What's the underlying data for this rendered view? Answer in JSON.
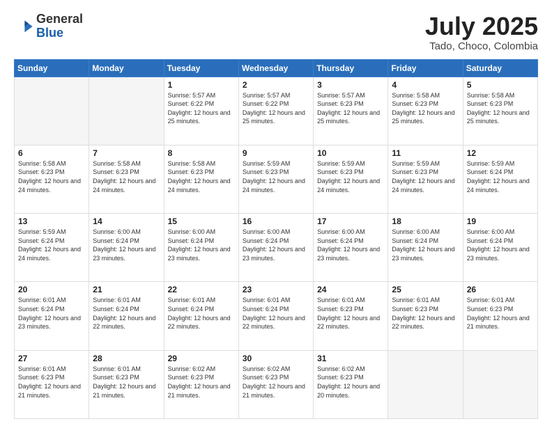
{
  "header": {
    "logo": {
      "line1": "General",
      "line2": "Blue"
    },
    "title": "July 2025",
    "location": "Tado, Choco, Colombia"
  },
  "weekdays": [
    "Sunday",
    "Monday",
    "Tuesday",
    "Wednesday",
    "Thursday",
    "Friday",
    "Saturday"
  ],
  "weeks": [
    [
      {
        "day": "",
        "empty": true
      },
      {
        "day": "",
        "empty": true
      },
      {
        "day": "1",
        "sunrise": "5:57 AM",
        "sunset": "6:22 PM",
        "daylight": "12 hours and 25 minutes."
      },
      {
        "day": "2",
        "sunrise": "5:57 AM",
        "sunset": "6:22 PM",
        "daylight": "12 hours and 25 minutes."
      },
      {
        "day": "3",
        "sunrise": "5:57 AM",
        "sunset": "6:23 PM",
        "daylight": "12 hours and 25 minutes."
      },
      {
        "day": "4",
        "sunrise": "5:58 AM",
        "sunset": "6:23 PM",
        "daylight": "12 hours and 25 minutes."
      },
      {
        "day": "5",
        "sunrise": "5:58 AM",
        "sunset": "6:23 PM",
        "daylight": "12 hours and 25 minutes."
      }
    ],
    [
      {
        "day": "6",
        "sunrise": "5:58 AM",
        "sunset": "6:23 PM",
        "daylight": "12 hours and 24 minutes."
      },
      {
        "day": "7",
        "sunrise": "5:58 AM",
        "sunset": "6:23 PM",
        "daylight": "12 hours and 24 minutes."
      },
      {
        "day": "8",
        "sunrise": "5:58 AM",
        "sunset": "6:23 PM",
        "daylight": "12 hours and 24 minutes."
      },
      {
        "day": "9",
        "sunrise": "5:59 AM",
        "sunset": "6:23 PM",
        "daylight": "12 hours and 24 minutes."
      },
      {
        "day": "10",
        "sunrise": "5:59 AM",
        "sunset": "6:23 PM",
        "daylight": "12 hours and 24 minutes."
      },
      {
        "day": "11",
        "sunrise": "5:59 AM",
        "sunset": "6:23 PM",
        "daylight": "12 hours and 24 minutes."
      },
      {
        "day": "12",
        "sunrise": "5:59 AM",
        "sunset": "6:24 PM",
        "daylight": "12 hours and 24 minutes."
      }
    ],
    [
      {
        "day": "13",
        "sunrise": "5:59 AM",
        "sunset": "6:24 PM",
        "daylight": "12 hours and 24 minutes."
      },
      {
        "day": "14",
        "sunrise": "6:00 AM",
        "sunset": "6:24 PM",
        "daylight": "12 hours and 23 minutes."
      },
      {
        "day": "15",
        "sunrise": "6:00 AM",
        "sunset": "6:24 PM",
        "daylight": "12 hours and 23 minutes."
      },
      {
        "day": "16",
        "sunrise": "6:00 AM",
        "sunset": "6:24 PM",
        "daylight": "12 hours and 23 minutes."
      },
      {
        "day": "17",
        "sunrise": "6:00 AM",
        "sunset": "6:24 PM",
        "daylight": "12 hours and 23 minutes."
      },
      {
        "day": "18",
        "sunrise": "6:00 AM",
        "sunset": "6:24 PM",
        "daylight": "12 hours and 23 minutes."
      },
      {
        "day": "19",
        "sunrise": "6:00 AM",
        "sunset": "6:24 PM",
        "daylight": "12 hours and 23 minutes."
      }
    ],
    [
      {
        "day": "20",
        "sunrise": "6:01 AM",
        "sunset": "6:24 PM",
        "daylight": "12 hours and 23 minutes."
      },
      {
        "day": "21",
        "sunrise": "6:01 AM",
        "sunset": "6:24 PM",
        "daylight": "12 hours and 22 minutes."
      },
      {
        "day": "22",
        "sunrise": "6:01 AM",
        "sunset": "6:24 PM",
        "daylight": "12 hours and 22 minutes."
      },
      {
        "day": "23",
        "sunrise": "6:01 AM",
        "sunset": "6:24 PM",
        "daylight": "12 hours and 22 minutes."
      },
      {
        "day": "24",
        "sunrise": "6:01 AM",
        "sunset": "6:23 PM",
        "daylight": "12 hours and 22 minutes."
      },
      {
        "day": "25",
        "sunrise": "6:01 AM",
        "sunset": "6:23 PM",
        "daylight": "12 hours and 22 minutes."
      },
      {
        "day": "26",
        "sunrise": "6:01 AM",
        "sunset": "6:23 PM",
        "daylight": "12 hours and 21 minutes."
      }
    ],
    [
      {
        "day": "27",
        "sunrise": "6:01 AM",
        "sunset": "6:23 PM",
        "daylight": "12 hours and 21 minutes."
      },
      {
        "day": "28",
        "sunrise": "6:01 AM",
        "sunset": "6:23 PM",
        "daylight": "12 hours and 21 minutes."
      },
      {
        "day": "29",
        "sunrise": "6:02 AM",
        "sunset": "6:23 PM",
        "daylight": "12 hours and 21 minutes."
      },
      {
        "day": "30",
        "sunrise": "6:02 AM",
        "sunset": "6:23 PM",
        "daylight": "12 hours and 21 minutes."
      },
      {
        "day": "31",
        "sunrise": "6:02 AM",
        "sunset": "6:23 PM",
        "daylight": "12 hours and 20 minutes."
      },
      {
        "day": "",
        "empty": true
      },
      {
        "day": "",
        "empty": true
      }
    ]
  ]
}
